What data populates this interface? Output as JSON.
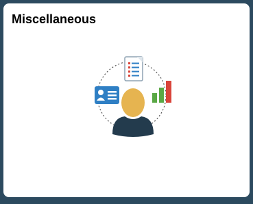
{
  "tile": {
    "title": "Miscellaneous",
    "image_icon": "person-with-profile-card-checklist-and-chart-icon"
  },
  "colors": {
    "background": "#2c4a5f",
    "tile_background": "#ffffff",
    "title_text": "#000000",
    "person_head": "#e6b450",
    "person_body": "#233b4d",
    "card_blue": "#2f7fc4",
    "chart_green": "#5aa845",
    "chart_red": "#d9443a",
    "checklist_border": "#8fa3b3"
  }
}
